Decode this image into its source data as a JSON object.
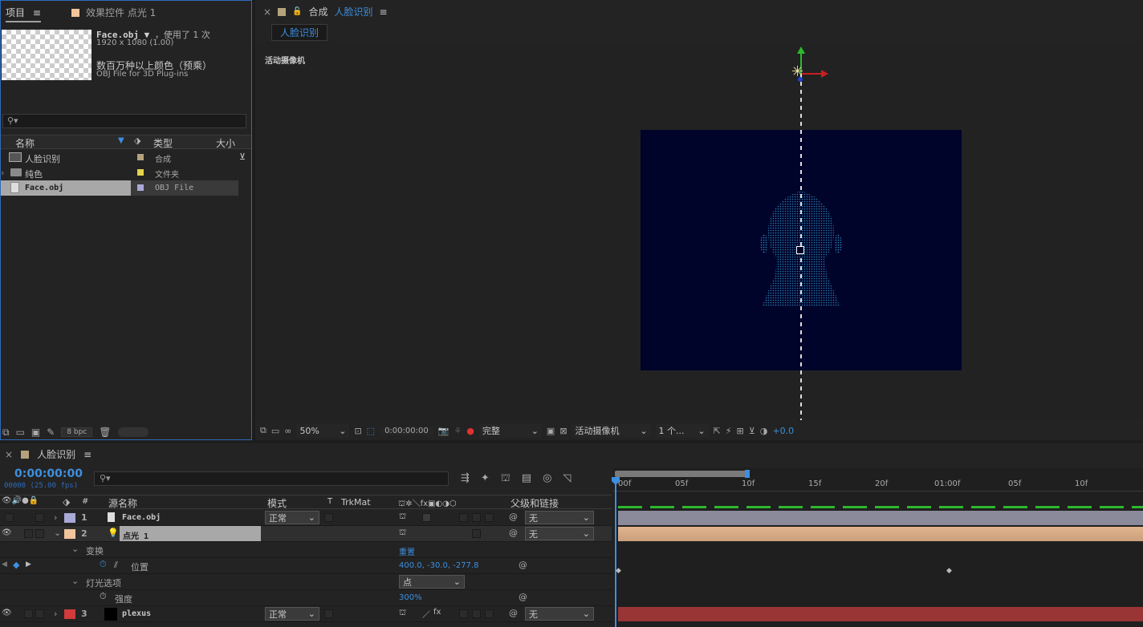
{
  "project_panel": {
    "tab_project": "项目",
    "tab_effects": "效果控件 点光 1",
    "preview_name": "Face.obj",
    "preview_used": "，使用了 1 次",
    "preview_res": "1920 x 1080 (1.00)",
    "preview_color": "数百万种以上颜色（预乘）",
    "preview_type": "OBJ File for 3D Plug-ins",
    "search_placeholder": "",
    "col_name": "名称",
    "col_type": "类型",
    "col_size": "大小",
    "items": [
      {
        "name": "人脸识别",
        "type": "合成",
        "color": "#b5a27c"
      },
      {
        "name": "纯色",
        "type": "文件夹",
        "color": "#e6d34a"
      },
      {
        "name": "Face.obj",
        "type": "OBJ File",
        "color": "#a9a9d8"
      }
    ],
    "bpc": "8 bpc"
  },
  "comp_viewer": {
    "tab_prefix": "合成",
    "tab_name": "人脸识别",
    "subtab": "人脸识别",
    "camera_label": "活动摄像机",
    "zoom": "50%",
    "timecode": "0:00:00:00",
    "resolution": "完整",
    "view_camera": "活动摄像机",
    "views": "1 个...",
    "exposure": "+0.0",
    "colors": {
      "comp_bg": "#00032a",
      "head": "#2f8fc0"
    }
  },
  "timeline": {
    "tab_name": "人脸识别",
    "current_time": "0:00:00:00",
    "fps_label": "00000 (25.00 fps)",
    "col_source": "源名称",
    "col_mode": "模式",
    "col_t": "T",
    "col_trkmat": "TrkMat",
    "col_parent": "父级和链接",
    "ruler": [
      "00f",
      "05f",
      "10f",
      "15f",
      "20f",
      "01:00f",
      "05f",
      "10f"
    ],
    "layers": [
      {
        "num": "1",
        "name": "Face.obj",
        "mode": "正常",
        "parent": "无",
        "label_color": "#a9a9d8",
        "bar_color": "#8a8a9a"
      },
      {
        "num": "2",
        "name": "点光 1",
        "mode": "",
        "parent": "无",
        "label_color": "#f3c59b",
        "bar_color": "#c9a07c"
      },
      {
        "num": "3",
        "name": "plexus",
        "mode": "正常",
        "parent": "无",
        "label_color": "#d13b3b",
        "bar_color": "#9a3535"
      }
    ],
    "transform_label": "变换",
    "reset_label": "重置",
    "position_label": "位置",
    "position_value": "400.0, -30.0, -277.8",
    "light_options_label": "灯光选项",
    "light_type": "点",
    "intensity_label": "强度",
    "intensity_value": "300%"
  }
}
